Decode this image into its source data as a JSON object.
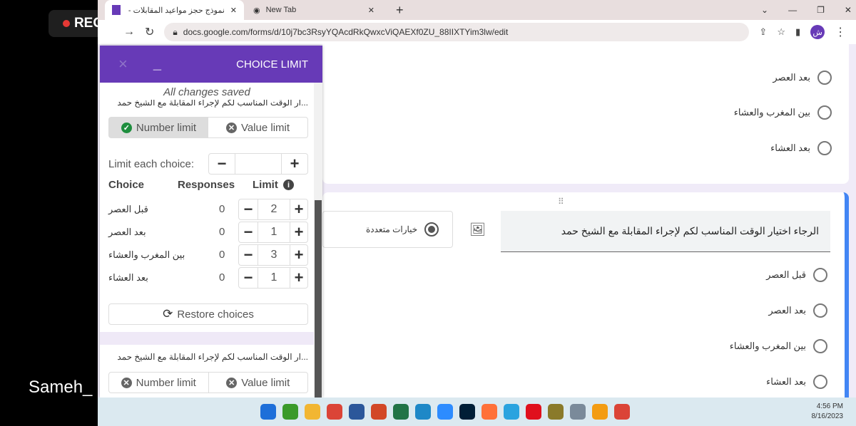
{
  "recorder": {
    "label": "REC",
    "caption": "Sameh_"
  },
  "browser": {
    "tabs": [
      {
        "label": "نموذج حجز مواعيد المقابلات - نماذ",
        "active": true
      },
      {
        "label": "New Tab",
        "active": false
      }
    ],
    "url": "docs.google.com/forms/d/10j7bc3RsyYQAcdRkQwxcViQAEXf0ZU_88IIXTYim3lw/edit",
    "profile_initial": "ش"
  },
  "form": {
    "card1_options": [
      "بعد العصر",
      "بين المغرب والعشاء",
      "بعد العشاء"
    ],
    "question": "الرجاء اختيار الوقت المناسب لكم لإجراء المقابلة مع الشيخ حمد",
    "question_type": "خيارات متعددة",
    "card2_options": [
      "قبل العصر",
      "بعد العصر",
      "بين المغرب والعشاء",
      "بعد العشاء"
    ]
  },
  "panel": {
    "title": "CHOICE LIMIT",
    "close": "×",
    "minimize": "_",
    "status": "All changes saved",
    "q1_title": "...ار الوقت المناسب لكم لإجراء المقابلة مع الشيخ حمد",
    "number_limit": "Number limit",
    "value_limit": "Value limit",
    "limit_each_label": "Limit each choice:",
    "limit_each_value": "",
    "headers": {
      "choice": "Choice",
      "responses": "Responses",
      "limit": "Limit"
    },
    "rows": [
      {
        "choice": "قبل العصر",
        "responses": "0",
        "limit": "2"
      },
      {
        "choice": "بعد العصر",
        "responses": "0",
        "limit": "1"
      },
      {
        "choice": "بين المغرب والعشاء",
        "responses": "0",
        "limit": "3"
      },
      {
        "choice": "بعد العشاء",
        "responses": "0",
        "limit": "1"
      }
    ],
    "restore": "Restore choices",
    "q2_title": "...ار الوقت المناسب لكم لإجراء المقابلة مع الشيخ حمد"
  },
  "taskbar": {
    "time": "4:56 PM",
    "date": "8/16/2023",
    "apps": [
      "windows-start",
      "camtasia",
      "file-explorer",
      "chrome",
      "word",
      "powerpoint",
      "excel",
      "desktop",
      "zoom",
      "photoshop",
      "firefox",
      "telegram",
      "opera",
      "app",
      "notepad",
      "app2",
      "chrome-profile"
    ]
  },
  "colors": {
    "accent": "#673ab7",
    "blue": "#4285f4",
    "green": "#1e8e3e"
  }
}
